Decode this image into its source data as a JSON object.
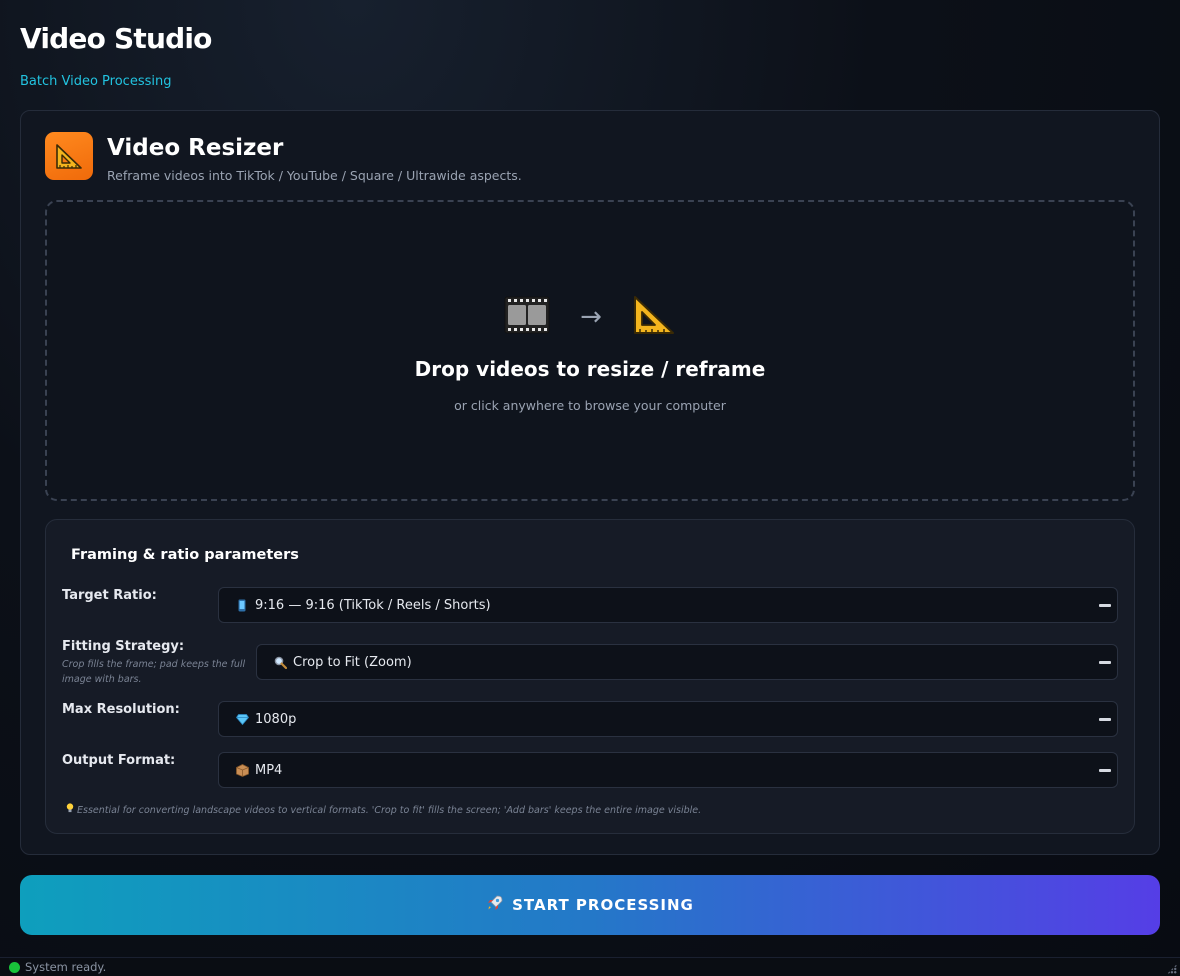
{
  "app": {
    "title": "Video Studio",
    "subtitle": "Batch Video Processing"
  },
  "tool": {
    "icon": "triangular-ruler-icon",
    "title": "Video Resizer",
    "description": "Reframe videos into TikTok / YouTube / Square / Ultrawide aspects."
  },
  "dropzone": {
    "icons": [
      "film-frames-icon",
      "arrow-right-icon",
      "triangular-ruler-icon"
    ],
    "arrow": "→",
    "title": "Drop videos to resize / reframe",
    "subtitle": "or click anywhere to browse your computer"
  },
  "params": {
    "title": "Framing & ratio parameters",
    "target_ratio": {
      "label": "Target Ratio:",
      "icon": "mobile-phone-icon",
      "value": "9:16 — 9:16 (TikTok / Reels / Shorts)"
    },
    "fitting_strategy": {
      "label": "Fitting Strategy:",
      "hint": "Crop fills the frame; pad keeps the full image with bars.",
      "icon": "magnifier-icon",
      "value": "Crop to Fit (Zoom)"
    },
    "max_resolution": {
      "label": "Max Resolution:",
      "icon": "gem-icon",
      "value": "1080p"
    },
    "output_format": {
      "label": "Output Format:",
      "icon": "package-icon",
      "value": "MP4"
    },
    "note": "Essential for converting landscape videos to vertical formats. 'Crop to fit' fills the screen; 'Add bars' keeps the entire image visible.",
    "note_icon": "lightbulb-icon"
  },
  "start_button": {
    "icon": "rocket-icon",
    "label": "START PROCESSING"
  },
  "status": {
    "text": "System ready.",
    "color": "#19c23a"
  },
  "colors": {
    "accent": "#22c3e0",
    "tool_icon_bg": "#f57a12",
    "button_gradient": [
      "#0e9fbd",
      "#553ee6"
    ]
  }
}
